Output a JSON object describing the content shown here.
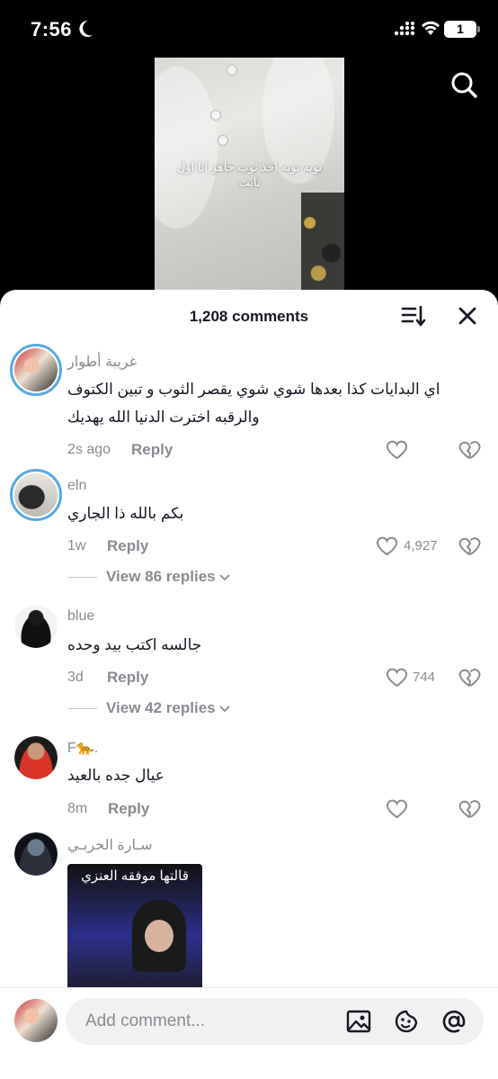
{
  "status_bar": {
    "time": "7:56",
    "battery": "1"
  },
  "video": {
    "caption": "توبه توبه اخذ ثوب جاهز انا اول تايب"
  },
  "sheet": {
    "title": "1,208 comments",
    "sort_icon": "sort-icon",
    "close_icon": "close-icon"
  },
  "comments": [
    {
      "username": "غريبة أطوار",
      "text": "اي البدايات كذا بعدها شوي شوي يقصر الثوب و تبين الكتوف والرقبه اخترت الدنيا الله يهديك",
      "time": "2s ago",
      "reply": "Reply",
      "likes": ""
    },
    {
      "username": "eln",
      "text": "بكم بالله ذا الجاري",
      "time": "1w",
      "reply": "Reply",
      "likes": "4,927",
      "view_replies": "View 86 replies"
    },
    {
      "username": "blue",
      "text": "جالسه اكتب بيد وحده",
      "time": "3d",
      "reply": "Reply",
      "likes": "744",
      "view_replies": "View 42 replies"
    },
    {
      "username": "F🐆.",
      "text": "عيال جده بالعيد",
      "time": "8m",
      "reply": "Reply",
      "likes": ""
    },
    {
      "username": "سـارة الحربـي",
      "gif_caption": "قالتها موفقه العنزي"
    }
  ],
  "composer": {
    "placeholder": "Add comment..."
  },
  "colors": {
    "accent_ring": "#56a9e6",
    "text_primary": "#161823",
    "text_secondary": "#8a8b91"
  }
}
